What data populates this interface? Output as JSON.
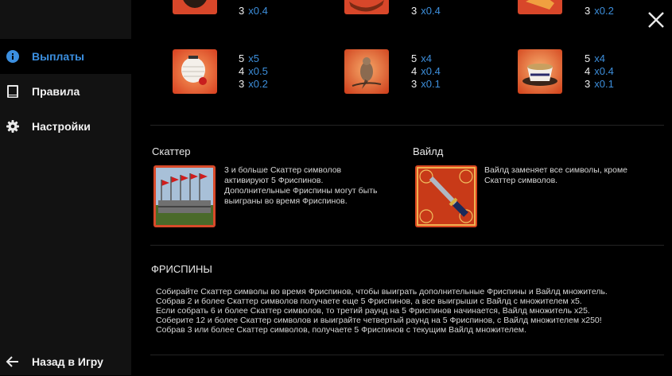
{
  "sidebar": {
    "items": [
      {
        "label": "Выплаты",
        "icon": "info-icon",
        "active": true
      },
      {
        "label": "Правила",
        "icon": "book-icon",
        "active": false
      },
      {
        "label": "Настройки",
        "icon": "gear-icon",
        "active": false
      }
    ],
    "back_label": "Назад в Игру"
  },
  "paytable": {
    "top_row": [
      {
        "lines": [
          {
            "count": "3",
            "mult": "x0.4"
          }
        ]
      },
      {
        "lines": [
          {
            "count": "3",
            "mult": "x0.4"
          }
        ]
      },
      {
        "lines": [
          {
            "count": "3",
            "mult": "x0.2"
          }
        ]
      }
    ],
    "second_row": [
      {
        "symbol": "lantern-symbol",
        "lines": [
          {
            "count": "5",
            "mult": "x5"
          },
          {
            "count": "4",
            "mult": "x0.5"
          },
          {
            "count": "3",
            "mult": "x0.2"
          }
        ]
      },
      {
        "symbol": "bird-symbol",
        "lines": [
          {
            "count": "5",
            "mult": "x4"
          },
          {
            "count": "4",
            "mult": "x0.4"
          },
          {
            "count": "3",
            "mult": "x0.1"
          }
        ]
      },
      {
        "symbol": "teacup-symbol",
        "lines": [
          {
            "count": "5",
            "mult": "x4"
          },
          {
            "count": "4",
            "mult": "x0.4"
          },
          {
            "count": "3",
            "mult": "x0.1"
          }
        ]
      }
    ]
  },
  "scatter": {
    "title": "Скаттер",
    "desc": [
      "3 и больше Скаттер символов",
      "активируют 5 Фриспинов.",
      "Дополнительные Фриспины могут быть",
      "выиграны во время Фриспинов."
    ]
  },
  "wild": {
    "title": "Вайлд",
    "desc": [
      "Вайлд заменяет все символы, кроме",
      "Скаттер символов."
    ]
  },
  "freespins": {
    "title": "ФРИСПИНЫ",
    "lines": [
      "Собирайте Скаттер символы во время Фриспинов, чтобы выиграть дополнительные Фриспины и Вайлд множитель.",
      "Собрав 2 и более Скаттер символов получаете еще 5 Фриспинов, а все выигрыши с Вайлд с множителем x5.",
      "Если собрать 6 и более Скаттер символов, то третий раунд на 5 Фриспинов начинается, Вайлд множитель x25.",
      "Соберите 12 и более Скаттер символов и выиграйте четвертый раунд на 5 Фриспинов, с Вайлд множителем x250!",
      "Собрав 3 или более Скаттер символов, получаете 5 Фриспинов с текущим Вайлд множителем."
    ]
  },
  "colors": {
    "accent": "#3b8fe0",
    "sidebar_bg": "#121212",
    "bg": "#000000"
  }
}
